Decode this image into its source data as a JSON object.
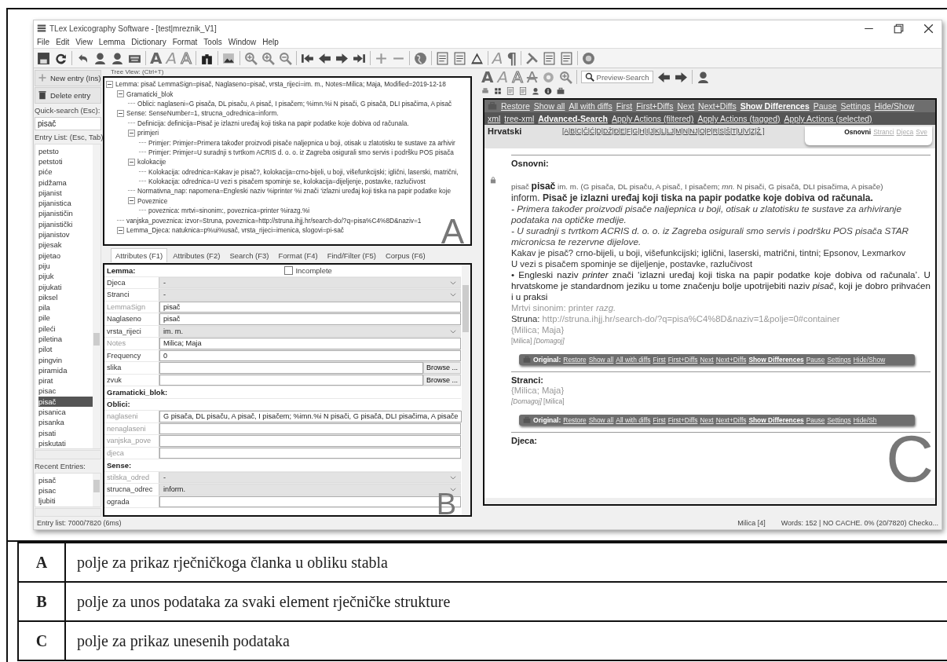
{
  "window": {
    "title": "TLex Lexicography Software - [test|mreznik_V1]"
  },
  "menu": [
    "File",
    "Edit",
    "View",
    "Lemma",
    "Dictionary",
    "Format",
    "Tools",
    "Window",
    "Help"
  ],
  "toolbar_glyphs": [
    "A",
    "A",
    "A",
    "A",
    "¶"
  ],
  "sidebar": {
    "new_button": "New entry (Ins)",
    "delete_button": "Delete entry",
    "quick_search_label": "Quick-search (Esc):",
    "quick_search_value": "pisač",
    "entry_list_label": "Entry List: (Esc, Tab)",
    "entries": [
      {
        "text": "petsto",
        "selected": false
      },
      {
        "text": "petstoti",
        "selected": false
      },
      {
        "text": "piće",
        "selected": false
      },
      {
        "text": "pidžama",
        "selected": false
      },
      {
        "text": "pijanist",
        "selected": false
      },
      {
        "text": "pijanistica",
        "selected": false
      },
      {
        "text": "pijanističin",
        "selected": false
      },
      {
        "text": "pijanistički",
        "selected": false
      },
      {
        "text": "pijanistov",
        "selected": false
      },
      {
        "text": "pijesak",
        "selected": false
      },
      {
        "text": "pijetao",
        "selected": false
      },
      {
        "text": "piju",
        "selected": false
      },
      {
        "text": "pijuk",
        "selected": false
      },
      {
        "text": "pijukati",
        "selected": false
      },
      {
        "text": "piksel",
        "selected": false
      },
      {
        "text": "pila",
        "selected": false
      },
      {
        "text": "pile",
        "selected": false
      },
      {
        "text": "pileći",
        "selected": false
      },
      {
        "text": "piletina",
        "selected": false
      },
      {
        "text": "pilot",
        "selected": false
      },
      {
        "text": "pingvin",
        "selected": false
      },
      {
        "text": "piramida",
        "selected": false
      },
      {
        "text": "pirat",
        "selected": false
      },
      {
        "text": "pisac",
        "selected": false
      },
      {
        "text": "pisač",
        "selected": true
      },
      {
        "text": "pisanica",
        "selected": false
      },
      {
        "text": "pisanka",
        "selected": false
      },
      {
        "text": "pisati",
        "selected": false
      },
      {
        "text": "piskutati",
        "selected": false
      }
    ],
    "recent_label": "Recent Entries:",
    "recent": [
      "pisač",
      "pisac",
      "ljubiti"
    ]
  },
  "tree_view": {
    "title": "Tree View: (Ctrl+T)",
    "marker": "A",
    "nodes": [
      {
        "text": "Lemma: pisač  LemmaSign=pisač, Naglaseno=pisač, vrsta_rijeci=im. m., Notes=Milica; Maja, Modified=2019-12-18",
        "expanded": true,
        "children": [
          {
            "text": "Gramaticki_blok",
            "expanded": true,
            "children": [
              {
                "text": "Oblici:  naglaseni=G pisača, DL pisaču, A pisač, I pisačem; %imn.%i N pisači, G pisačā, DLI pisačima, A pisač"
              }
            ]
          },
          {
            "text": "Sense:  SenseNumber=1, strucna_odrednica=inform.",
            "expanded": true,
            "children": [
              {
                "text": "Definicija:  definicija=Pisač je izlazni uređaj koji tiska na papir podatke koje dobiva od računala."
              },
              {
                "text": "primjeri",
                "expanded": true,
                "children": [
                  {
                    "text": "Primjer:  Primjer=Primera također proizvodi pisače naljepnica u boji, otisak u zlatotisku te sustave za arhivir"
                  },
                  {
                    "text": "Primjer:  Primjer=U suradnji s tvrtkom ACRIS d. o. o. iz Zagreba osigurali smo servis i podršku POS pisača"
                  }
                ]
              },
              {
                "text": "kolokacije",
                "expanded": true,
                "children": [
                  {
                    "text": "Kolokacija:  odrednica=Kakav je pisač?, kolokacija=crno-bijeli, u boji, višefunkcijski; iglični, laserski, matrični,"
                  },
                  {
                    "text": "Kolokacija:  odrednica=U vezi s pisačem spominje se, kolokacija=dijeljenje, postavke, razlučivost"
                  }
                ]
              },
              {
                "text": "Normativna_nap:  napomena=Engleski naziv %iprinter %i znači ‘izlazni uređaj koji tiska na papir podatke koje"
              },
              {
                "text": "Poveznice",
                "expanded": true,
                "children": [
                  {
                    "text": "poveznica:  mrtvi=sinonim:, poveznica=printer %irazg.%i"
                  }
                ]
              }
            ]
          },
          {
            "text": "vanjska_poveznica:  izvor=Struna, poveznica=http://struna.ihjj.hr/search-do/?q=pisa%C4%8D&naziv=1"
          },
          {
            "text": "Lemma_Djeca:  natuknica=p%ui%usač, vrsta_rijeci=imenica, slogovi=pi-sač",
            "expanded": true
          }
        ]
      }
    ]
  },
  "editor": {
    "tabs": [
      {
        "label": "Attributes (F1)",
        "selected": true
      },
      {
        "label": "Attributes (F2)",
        "selected": false
      },
      {
        "label": "Search (F3)",
        "selected": false
      },
      {
        "label": "Format (F4)",
        "selected": false
      },
      {
        "label": "Find/Filter (F5)",
        "selected": false
      },
      {
        "label": "Corpus (F6)",
        "selected": false
      }
    ],
    "marker": "B",
    "rows": [
      {
        "kind": "header",
        "label": "Lemma:",
        "checkbox": {
          "label": "Incomplete",
          "checked": false
        }
      },
      {
        "kind": "select",
        "label": "Djeca",
        "value": "-",
        "dim": false
      },
      {
        "kind": "select",
        "label": "Stranci",
        "value": "-",
        "dim": false
      },
      {
        "kind": "text",
        "label": "LemmaSign",
        "value": "pisač",
        "dim": true
      },
      {
        "kind": "text",
        "label": "Naglaseno",
        "value": "pisač",
        "dim": false
      },
      {
        "kind": "select",
        "label": "vrsta_rijeci",
        "value": "im. m.",
        "dim": false
      },
      {
        "kind": "text",
        "label": "Notes",
        "value": "Milica; Maja",
        "dim": true
      },
      {
        "kind": "text",
        "label": "Frequency",
        "value": "0",
        "dim": false
      },
      {
        "kind": "file",
        "label": "slika",
        "button": "Browse ...",
        "dim": false
      },
      {
        "kind": "file",
        "label": "zvuk",
        "button": "Browse ...",
        "dim": false
      },
      {
        "kind": "header",
        "label": "Gramaticki_blok:"
      },
      {
        "kind": "header",
        "label": "Oblici:"
      },
      {
        "kind": "text",
        "label": "naglaseni",
        "value": "G pisača, DL pisaču, A pisač, I pisačem; %imn.%i N pisači, G pisačā, DLI pisačima, A pisače",
        "dim": true
      },
      {
        "kind": "text",
        "label": "nenaglaseni",
        "dim": true
      },
      {
        "kind": "text",
        "label": "vanjska_pove",
        "dim": true
      },
      {
        "kind": "text",
        "label": "djeca",
        "dim": true
      },
      {
        "kind": "header",
        "label": "Sense:"
      },
      {
        "kind": "select",
        "label": "stilska_odred",
        "value": "-",
        "dim": true
      },
      {
        "kind": "select",
        "label": "strucna_odrec",
        "value": "inform.",
        "dim": false
      },
      {
        "kind": "text",
        "label": "ograda",
        "dim": false
      }
    ]
  },
  "preview": {
    "glyphs": [
      "A",
      "A",
      "A",
      "A"
    ],
    "search_placeholder": "Preview-Search",
    "marker": "C",
    "bar_links": [
      {
        "text": "Restore",
        "bold": false
      },
      {
        "text": "Show all",
        "bold": false
      },
      {
        "text": "All with diffs",
        "bold": false
      },
      {
        "text": "First",
        "bold": false
      },
      {
        "text": "First+Diffs",
        "bold": false
      },
      {
        "text": "Next",
        "bold": false
      },
      {
        "text": "Next+Diffs",
        "bold": false
      },
      {
        "text": "Show Differences",
        "bold": true
      },
      {
        "text": "Pause",
        "bold": false
      },
      {
        "text": "Settings",
        "bold": false
      },
      {
        "text": "Hide/Show",
        "bold": false
      }
    ],
    "action_links": [
      {
        "text": "xml",
        "bold": false
      },
      {
        "text": "tree-xml",
        "bold": false
      },
      {
        "text": "Advanced-Search",
        "bold": true
      },
      {
        "text": "Apply Actions (filtered)",
        "bold": false
      },
      {
        "text": "Apply Actions (tagged)",
        "bold": false
      },
      {
        "text": "Apply Actions (selected)",
        "bold": false
      }
    ],
    "language": "Hrvatski",
    "alphabet": "[A|B|C|Č|Ć|D|DŽ|Đ|E|F|G|H|I|J|K|L|LJ|M|N|NJ|O|P|R|S|Š|T|U|V|Z|Ž ]",
    "views": [
      {
        "text": "Osnovni",
        "selected": true
      },
      {
        "text": "Stranci",
        "selected": false
      },
      {
        "text": "Djeca",
        "selected": false
      },
      {
        "text": "Sve",
        "selected": false
      }
    ],
    "sections": [
      {
        "title": "Osnovni:",
        "locked": true,
        "lines": [
          {
            "kind": "headword",
            "text": "pisač **pisač** im. m. (G pisača, DL pisaču, A pisač, I pisačem; *mn.* N pisači, G pisačā, DLI pisačima, A pisače)"
          },
          {
            "kind": "definition",
            "text": "inform. **Pisač je izlazni uređaj koji tiska na papir podatke koje dobiva od računala.**"
          },
          {
            "kind": "example",
            "text": "- Primera također proizvodi pisače naljepnica u boji, otisak u zlatotisku te sustave za arhiviranje podataka na optičke medije."
          },
          {
            "kind": "example",
            "text": "- U suradnji s tvrtkom ACRIS d. o. o. iz Zagreba osigurali smo servis i podršku POS pisača STAR micronicsa te rezervne dijelove."
          },
          {
            "kind": "plain",
            "text": "Kakav je pisač? crno-bijeli, u boji, višefunkcijski; iglični, laserski, matrični,  tintni; Epsonov, Lexmarkov"
          },
          {
            "kind": "plain",
            "text": "U vezi s pisačem spominje se dijeljenje, postavke, razlučivost"
          },
          {
            "kind": "note",
            "text": "• Engleski naziv *printer* znači ‘izlazni uređaj koji tiska na papir podatke koje dobiva od računala’. U hrvatskome je standardnom jeziku u tome značenju bolje upotrijebiti naziv *pisač*, koji je dobro prihvaćen i u praksi"
          },
          {
            "kind": "muted",
            "text": "Mrtvi sinonim: printer *razg.*"
          },
          {
            "kind": "source",
            "label": "Struna:",
            "url": "http://struna.ihjj.hr/search-do/?q=pisa%C4%8D&naziv=1&polje=0#container"
          },
          {
            "kind": "muted",
            "text": "{Milica; Maja}"
          },
          {
            "kind": "authors",
            "text": "[Milica] *[Domagoj]*"
          }
        ],
        "original_bar": {
          "label": "Original:",
          "links": [
            {
              "text": "Restore",
              "bold": false
            },
            {
              "text": "Show all",
              "bold": false
            },
            {
              "text": "All with diffs",
              "bold": false
            },
            {
              "text": "First",
              "bold": false
            },
            {
              "text": "First+Diffs",
              "bold": false
            },
            {
              "text": "Next",
              "bold": false
            },
            {
              "text": "Next+Diffs",
              "bold": false
            },
            {
              "text": "Show Differences",
              "bold": true
            },
            {
              "text": "Pause",
              "bold": false
            },
            {
              "text": "Settings",
              "bold": false
            },
            {
              "text": "Hide/Show",
              "bold": false
            }
          ]
        }
      },
      {
        "title": "Stranci:",
        "locked": false,
        "lines": [
          {
            "kind": "muted",
            "text": "{Milica; Maja}"
          },
          {
            "kind": "authors",
            "text": "*[Domagoj]* [Milica]"
          }
        ],
        "original_bar": {
          "label": "Original:",
          "links": [
            {
              "text": "Restore",
              "bold": false
            },
            {
              "text": "Show all",
              "bold": false
            },
            {
              "text": "All with diffs",
              "bold": false
            },
            {
              "text": "First",
              "bold": false
            },
            {
              "text": "First+Diffs",
              "bold": false
            },
            {
              "text": "Next",
              "bold": false
            },
            {
              "text": "Next+Diffs",
              "bold": false
            },
            {
              "text": "Show Differences",
              "bold": true
            },
            {
              "text": "Pause",
              "bold": false
            },
            {
              "text": "Settings",
              "bold": false
            },
            {
              "text": "Hide/Sh",
              "bold": false
            }
          ]
        }
      },
      {
        "title": "Djeca:",
        "locked": false
      }
    ]
  },
  "status_bar": {
    "entry_count": "Entry list: 7000/7820 (6ms)",
    "user": "Milica [4]",
    "info": "Words: 152 | NO CACHE. 0% (20/7820) Checko..."
  },
  "legend": [
    {
      "letter": "A",
      "text": "polje za prikaz rječničkoga članka u obliku stabla"
    },
    {
      "letter": "B",
      "text": "polje za unos podataka za svaki element rječničke strukture"
    },
    {
      "letter": "C",
      "text": "polje za prikaz unesenih podataka"
    }
  ]
}
